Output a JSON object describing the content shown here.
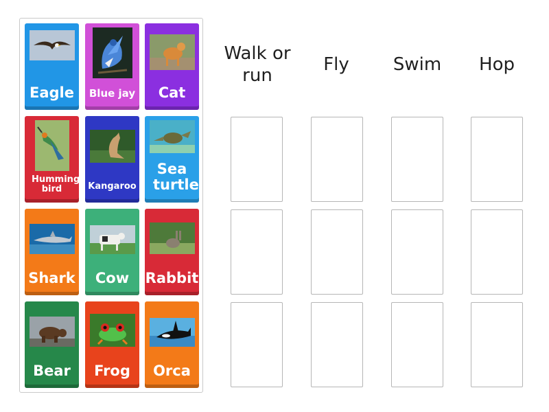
{
  "cards": [
    {
      "label": "Eagle",
      "color": "#2196e6",
      "image": "eagle-photo"
    },
    {
      "label": "Blue jay",
      "color": "#d150d8",
      "image": "blue-jay-photo"
    },
    {
      "label": "Cat",
      "color": "#8b2fe0",
      "image": "cat-photo"
    },
    {
      "label": "Humming bird",
      "color": "#d82a37",
      "image": "hummingbird-photo"
    },
    {
      "label": "Kangaroo",
      "color": "#2e38c4",
      "image": "kangaroo-photo"
    },
    {
      "label": "Sea turtle",
      "color": "#2aa0e8",
      "image": "sea-turtle-photo"
    },
    {
      "label": "Shark",
      "color": "#f37a18",
      "image": "shark-photo"
    },
    {
      "label": "Cow",
      "color": "#3db07a",
      "image": "cow-photo"
    },
    {
      "label": "Rabbit",
      "color": "#d82a37",
      "image": "rabbit-photo"
    },
    {
      "label": "Bear",
      "color": "#26884a",
      "image": "bear-photo"
    },
    {
      "label": "Frog",
      "color": "#e8431c",
      "image": "frog-photo"
    },
    {
      "label": "Orca",
      "color": "#f37a18",
      "image": "orca-photo"
    }
  ],
  "categories": [
    {
      "label": "Walk or run"
    },
    {
      "label": "Fly"
    },
    {
      "label": "Swim"
    },
    {
      "label": "Hop"
    }
  ]
}
